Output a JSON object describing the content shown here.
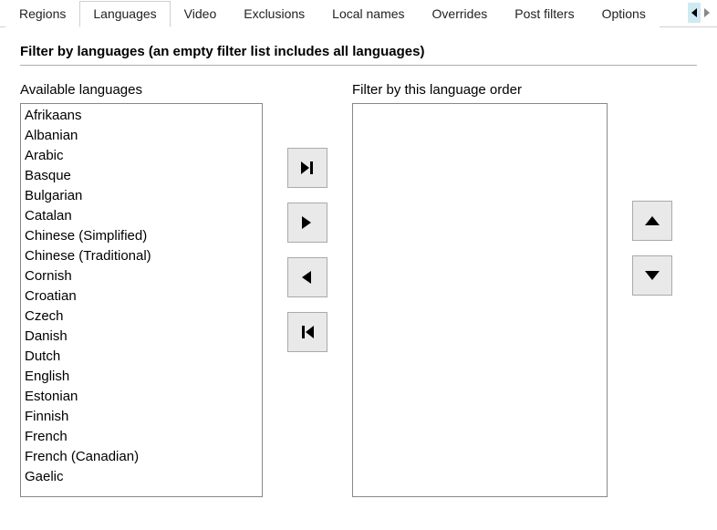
{
  "tabs": [
    {
      "label": "Regions",
      "active": false
    },
    {
      "label": "Languages",
      "active": true
    },
    {
      "label": "Video",
      "active": false
    },
    {
      "label": "Exclusions",
      "active": false
    },
    {
      "label": "Local names",
      "active": false
    },
    {
      "label": "Overrides",
      "active": false
    },
    {
      "label": "Post filters",
      "active": false
    },
    {
      "label": "Options",
      "active": false
    }
  ],
  "panel": {
    "title": "Filter by languages (an empty filter list includes all languages)",
    "available_label": "Available languages",
    "filter_label": "Filter by this language order"
  },
  "available_languages": [
    "Afrikaans",
    "Albanian",
    "Arabic",
    "Basque",
    "Bulgarian",
    "Catalan",
    "Chinese (Simplified)",
    "Chinese (Traditional)",
    "Cornish",
    "Croatian",
    "Czech",
    "Danish",
    "Dutch",
    "English",
    "Estonian",
    "Finnish",
    "French",
    "French (Canadian)",
    "Gaelic"
  ],
  "filter_languages": [],
  "buttons": {
    "move_all_right": "move-all-right",
    "move_right": "move-right",
    "move_left": "move-left",
    "move_all_left": "move-all-left",
    "move_up": "move-up",
    "move_down": "move-down"
  }
}
